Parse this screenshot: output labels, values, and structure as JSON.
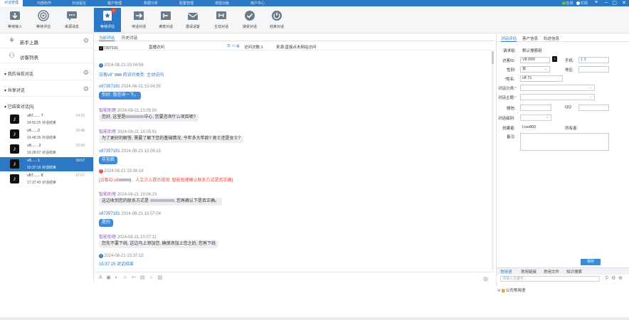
{
  "topnav": {
    "tabs": [
      "对话管理",
      "内部协作",
      "对话留言",
      "客户管理",
      "数据分析",
      "配置管理",
      "增强功能",
      "用户中心"
    ],
    "active_tab": "对话管理",
    "status_online": "在线",
    "status_busy": "忙碌",
    "colors": {
      "bar": "#2d78c4",
      "online": "#67c23a",
      "busy": "#3f8ad8"
    }
  },
  "toolbar": {
    "buttons": [
      "等待接入",
      "等待评估",
      "来源消息",
      "等待评估",
      "结束对话",
      "转移对话",
      "邀请协作",
      "主动对话",
      "接管对话",
      "结束对话"
    ],
    "labels": {
      "b1": "等待接入",
      "b2": "等待评估",
      "b3": "来源消息",
      "b4": "等待评估",
      "b5": "待话对话",
      "b6": "满意对话",
      "b7": "邀请话客",
      "b8": "主动对话",
      "b9": "接受对话",
      "b10": "结束对话"
    },
    "badge": "1"
  },
  "sidebar": {
    "new_visitor": "新手上路",
    "visitor_list": "访客列表",
    "my_current": "我的当前对话",
    "shared": "共享对话",
    "ended": "已结束对话[5]",
    "conversations": [
      {
        "name": "v87...... 7",
        "sub": "14:50:25 对话结束",
        "time": "14:20"
      },
      {
        "name": "v8......2",
        "sub": "16:48:35 对话结束",
        "time": "16:48"
      },
      {
        "name": "v8...... 2",
        "sub": "16:28:07 对话结束",
        "time": "15:58"
      },
      {
        "name": "v8..... 1",
        "sub": "15:37:15 对话结束",
        "time": "15:07"
      },
      {
        "name": "v87...... 8",
        "sub": "17:37:43 对话结束",
        "time": "17:07"
      }
    ]
  },
  "chat": {
    "tab_current": "当前对话",
    "tab_history": "历史对话",
    "visitor_id": "v87397191",
    "visitor_label": "直播访问",
    "visit_count": "访问次数:1",
    "source": "来源:直接点击网站访问",
    "messages": [
      {
        "kind": "sys",
        "time": "2024-08-21 15:04:56",
        "text": "访客v8 的访问类型: 主动访问"
      },
      {
        "kind": "visitor",
        "name": "v87397191",
        "time": "2024-08-21 15:04:55",
        "text": "你好, 想咨询一下。"
      },
      {
        "kind": "robot",
        "name": "智能助理",
        "time": "2024-08-21 15:05:00",
        "text_a": "您好, 这里是",
        "text_b": "中心, 您要咨询什么项目呢?"
      },
      {
        "kind": "robot",
        "name": "智能助理",
        "time": "2024-08-21 15:05:51",
        "text": "为了更好的解答, 需要了解下您的基础情况, 今年多大年龄? 男士还是女士?"
      },
      {
        "kind": "visitor",
        "name": "v87397191",
        "time": "2024-08-21 15:06:15",
        "text": "存加我"
      },
      {
        "kind": "sys",
        "time": "2024-08-21 15:06:16",
        "text": "[访客ID:v8 ]、人工介入提示规则: 智能助理确认联系方式是否正确]"
      },
      {
        "kind": "robot",
        "name": "智能助理",
        "time": "2024-08-21 15:06:23",
        "text_a": "这边收到您的联系方式是",
        "text_b": ", 您再确认下是否正确。"
      },
      {
        "kind": "visitor",
        "name": "v87397191",
        "time": "2024-08-21 15:07:04",
        "text": "是的"
      },
      {
        "kind": "robot",
        "name": "智能助理",
        "time": "2024-08-21 15:07:11",
        "text": "您先不要下线, 这边马上添加您, 确保添加上您之后, 您再下线"
      },
      {
        "kind": "sys",
        "time": "2024-08-21 15:37:15",
        "text": "15:37:15 对话结束"
      }
    ],
    "composer_icons": "A ▣ ◐ ☺ ✄ ▤ ☆ ▨"
  },
  "right": {
    "tabs": [
      "对话评估",
      "客户信息",
      "轨迹信息"
    ],
    "active_tab": "对话评估",
    "request_info_label": "请求组:",
    "request_info_value": "默认搜索组",
    "visitor_id_label": "访客ID:",
    "visitor_id_value": "V8",
    "phone_label": "手机:",
    "phone_value": "1 3",
    "gender_label": "性别:",
    "gender_value": "女",
    "region_label": "地区:",
    "name_label": "姓名:",
    "name_value": "v8 71",
    "category_label": "对话分类:",
    "topic_label": "对话主题:",
    "wechat_label": "微信:",
    "qq_label": "QQ:",
    "level_label": "对话级别:",
    "creator_label": "创建者:",
    "creator_value": "Live800",
    "owner_label": "所有者:",
    "note_label": "备注:",
    "save_label": "保存",
    "phrase_tabs": [
      "常用语",
      "常用链接",
      "常用文件",
      "知识搜索"
    ],
    "keyword_placeholder": "请输入关键字...",
    "phrase_folder": "公司常用语"
  }
}
